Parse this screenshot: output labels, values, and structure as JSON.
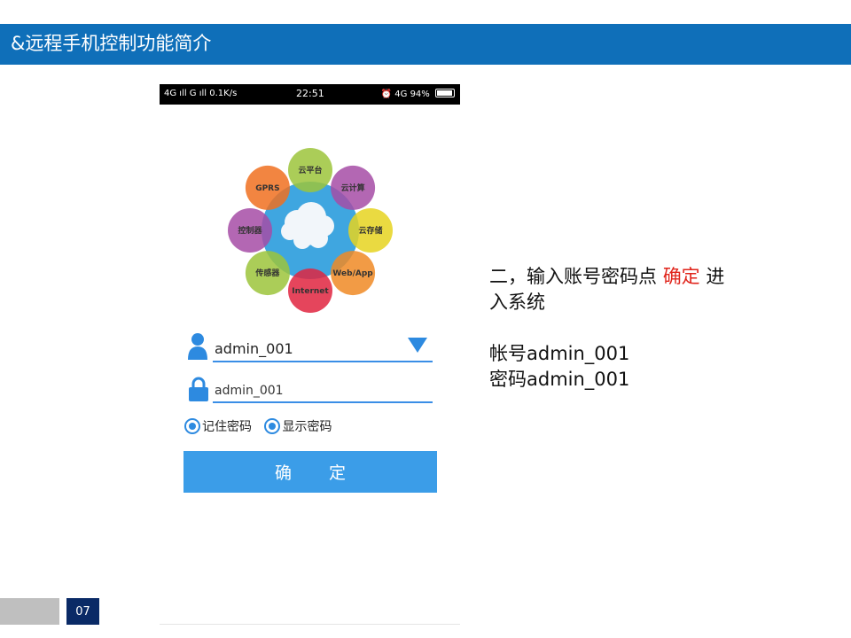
{
  "slide": {
    "title": "&远程手机控制功能简介",
    "page_number": "07",
    "colors": {
      "title_bar": "#0f6fb9",
      "page_badge": "#0a2a66",
      "highlight": "#e0241b",
      "button": "#3b9de8"
    }
  },
  "phone": {
    "status_bar": {
      "left": "4G ıll G ıll 0.1K/s",
      "time": "22:51",
      "right": "4G 94%",
      "battery_level": 0.94
    },
    "diagram": {
      "petals": [
        {
          "label": "云平台",
          "color": "#9cc43b"
        },
        {
          "label": "云计算",
          "color": "#a64ca6"
        },
        {
          "label": "云存储",
          "color": "#e6d320"
        },
        {
          "label": "Web/App",
          "color": "#f08a24"
        },
        {
          "label": "Internet",
          "color": "#e0243f"
        },
        {
          "label": "传感器",
          "color": "#9cc43b"
        },
        {
          "label": "控制器",
          "color": "#a64ca6"
        },
        {
          "label": "GPRS",
          "color": "#f07020"
        }
      ],
      "center_icon": "cloud-icon"
    },
    "login": {
      "username": "admin_001",
      "password": "admin_001",
      "remember_password": "记住密码",
      "show_password": "显示密码",
      "confirm": "确 定",
      "user_icon": "user-icon",
      "lock_icon": "lock-icon",
      "dropdown_icon": "dropdown-arrow-icon"
    }
  },
  "explanation": {
    "line1_prefix": "二，输入账号密码点",
    "line1_highlight": "确定",
    "line1_suffix": "进",
    "line2": "入系统",
    "account_label": "帐号",
    "account_value": "admin_001",
    "password_label": "密码",
    "password_value": "admin_001"
  }
}
